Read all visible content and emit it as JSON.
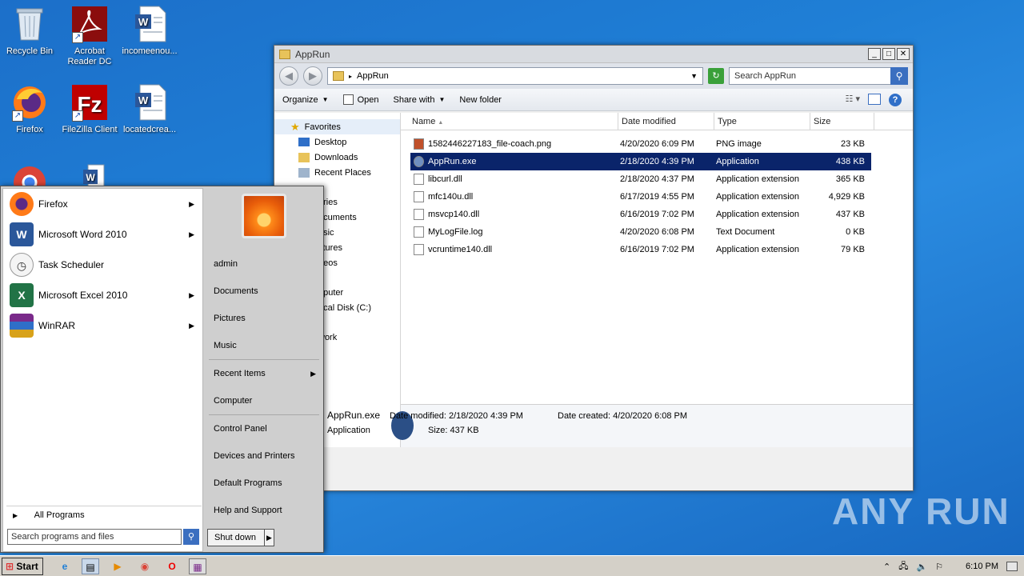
{
  "desktop": {
    "icons": [
      {
        "label": "Recycle Bin"
      },
      {
        "label": "Acrobat\nReader DC"
      },
      {
        "label": "incomeenou..."
      },
      {
        "label": "Firefox"
      },
      {
        "label": "FileZilla Client"
      },
      {
        "label": "locatedcrea..."
      }
    ],
    "watermark": "ANY RUN"
  },
  "explorer": {
    "title": "AppRun",
    "address": "AppRun",
    "search_placeholder": "Search AppRun",
    "toolbar": {
      "organize": "Organize",
      "open": "Open",
      "share_with": "Share with",
      "new_folder": "New folder"
    },
    "nav": {
      "favorites": "Favorites",
      "favorites_items": [
        "Desktop",
        "Downloads",
        "Recent Places"
      ],
      "partial_items": [
        "aries",
        "ocuments",
        "usic",
        "ctures",
        "deos",
        "nputer",
        "ocal Disk (C:)",
        "work"
      ]
    },
    "columns": [
      "Name",
      "Date modified",
      "Type",
      "Size"
    ],
    "files": [
      {
        "name": "1582446227183_file-coach.png",
        "date": "4/20/2020 6:09 PM",
        "type": "PNG image",
        "size": "23 KB",
        "selected": false
      },
      {
        "name": "AppRun.exe",
        "date": "2/18/2020 4:39 PM",
        "type": "Application",
        "size": "438 KB",
        "selected": true
      },
      {
        "name": "libcurl.dll",
        "date": "2/18/2020 4:37 PM",
        "type": "Application extension",
        "size": "365 KB",
        "selected": false
      },
      {
        "name": "mfc140u.dll",
        "date": "6/17/2019 4:55 PM",
        "type": "Application extension",
        "size": "4,929 KB",
        "selected": false
      },
      {
        "name": "msvcp140.dll",
        "date": "6/16/2019 7:02 PM",
        "type": "Application extension",
        "size": "437 KB",
        "selected": false
      },
      {
        "name": "MyLogFile.log",
        "date": "4/20/2020 6:08 PM",
        "type": "Text Document",
        "size": "0 KB",
        "selected": false
      },
      {
        "name": "vcruntime140.dll",
        "date": "6/16/2019 7:02 PM",
        "type": "Application extension",
        "size": "79 KB",
        "selected": false
      }
    ],
    "details": {
      "name": "AppRun.exe",
      "modified": "Date modified: 2/18/2020 4:39 PM",
      "created": "Date created: 4/20/2020 6:08 PM",
      "type": "Application",
      "size": "Size: 437 KB"
    }
  },
  "start_menu": {
    "programs": [
      "Firefox",
      "Microsoft Word 2010",
      "Task Scheduler",
      "Microsoft Excel 2010",
      "WinRAR"
    ],
    "all_programs": "All Programs",
    "search_placeholder": "Search programs and files",
    "right": [
      "admin",
      "Documents",
      "Pictures",
      "Music",
      "Recent Items",
      "Computer",
      "Control Panel",
      "Devices and Printers",
      "Default Programs",
      "Help and Support"
    ],
    "shutdown": "Shut down"
  },
  "taskbar": {
    "start": "Start",
    "clock": "6:10 PM"
  }
}
